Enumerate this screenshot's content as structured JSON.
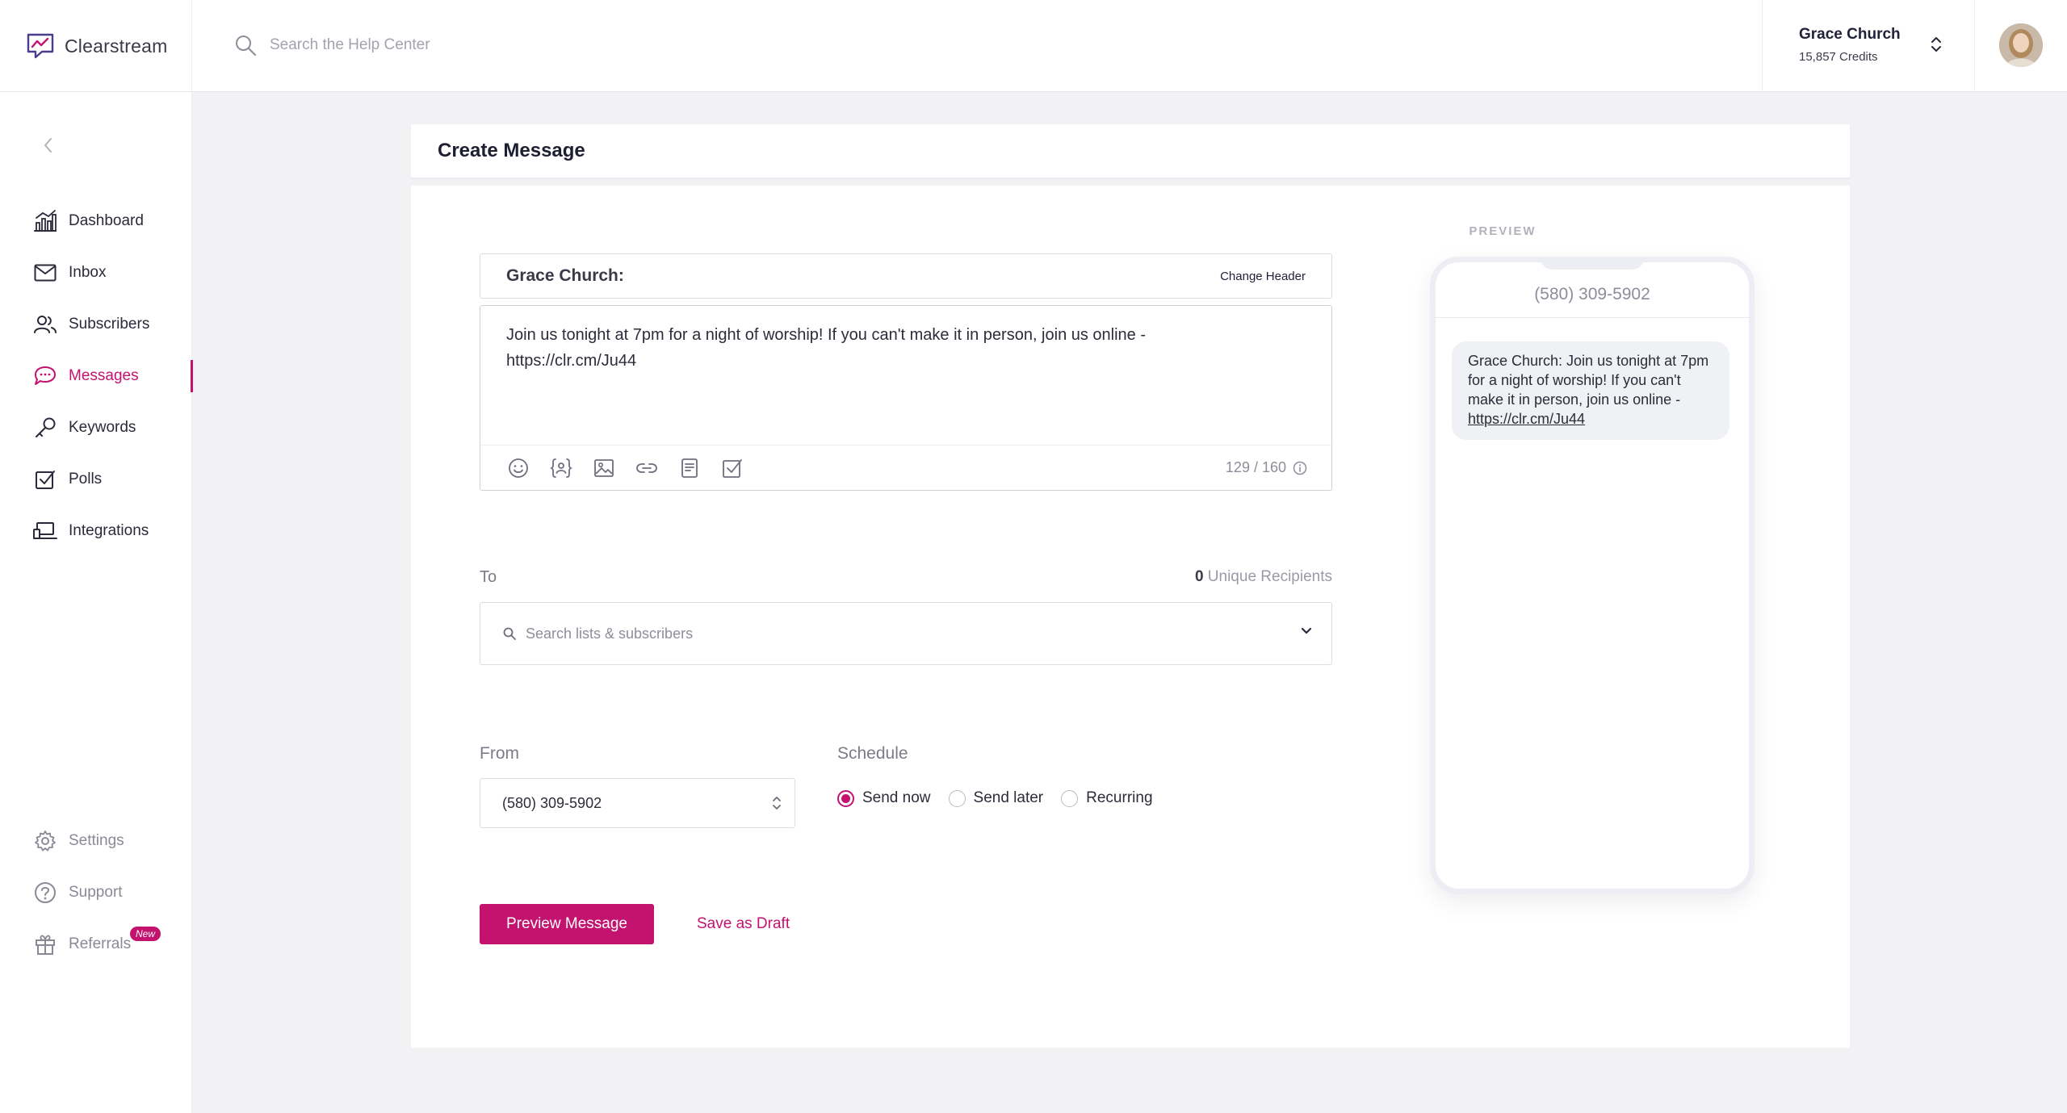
{
  "app": {
    "name": "Clearstream",
    "brand_color": "#c4126f"
  },
  "header": {
    "search_placeholder": "Search the Help Center",
    "account_name": "Grace Church",
    "account_credits": "15,857 Credits"
  },
  "sidebar": {
    "items": [
      {
        "label": "Dashboard",
        "icon": "chart-icon"
      },
      {
        "label": "Inbox",
        "icon": "envelope-icon"
      },
      {
        "label": "Subscribers",
        "icon": "users-icon"
      },
      {
        "label": "Messages",
        "icon": "chat-bubbles-icon",
        "active": true
      },
      {
        "label": "Keywords",
        "icon": "key-icon"
      },
      {
        "label": "Polls",
        "icon": "checkbox-icon"
      },
      {
        "label": "Integrations",
        "icon": "laptop-icon"
      }
    ],
    "bottom_items": [
      {
        "label": "Settings",
        "icon": "gear-icon"
      },
      {
        "label": "Support",
        "icon": "question-icon"
      },
      {
        "label": "Referrals",
        "icon": "gift-icon",
        "badge": "New"
      }
    ]
  },
  "page": {
    "title": "Create Message"
  },
  "composer": {
    "header_name": "Grace Church:",
    "change_header_label": "Change Header",
    "message_line1": "Join us tonight at 7pm for a night of worship! If you can't make it in person, join us online -",
    "message_line2": "https://clr.cm/Ju44",
    "char_count": "129 / 160"
  },
  "to": {
    "label": "To",
    "recipient_count": "0",
    "recipient_suffix": "Unique Recipients",
    "search_placeholder": "Search lists & subscribers"
  },
  "from": {
    "label": "From",
    "value": "(580) 309-5902"
  },
  "schedule": {
    "label": "Schedule",
    "options": [
      {
        "label": "Send now",
        "checked": true
      },
      {
        "label": "Send later",
        "checked": false
      },
      {
        "label": "Recurring",
        "checked": false
      }
    ]
  },
  "actions": {
    "preview_label": "Preview Message",
    "draft_label": "Save as Draft"
  },
  "preview": {
    "label": "PREVIEW",
    "phone_number": "(580) 309-5902",
    "bubble_text": "Grace Church: Join us tonight at 7pm for a night of worship! If you can't make it in person, join us online - ",
    "bubble_link": "https://clr.cm/Ju44"
  }
}
